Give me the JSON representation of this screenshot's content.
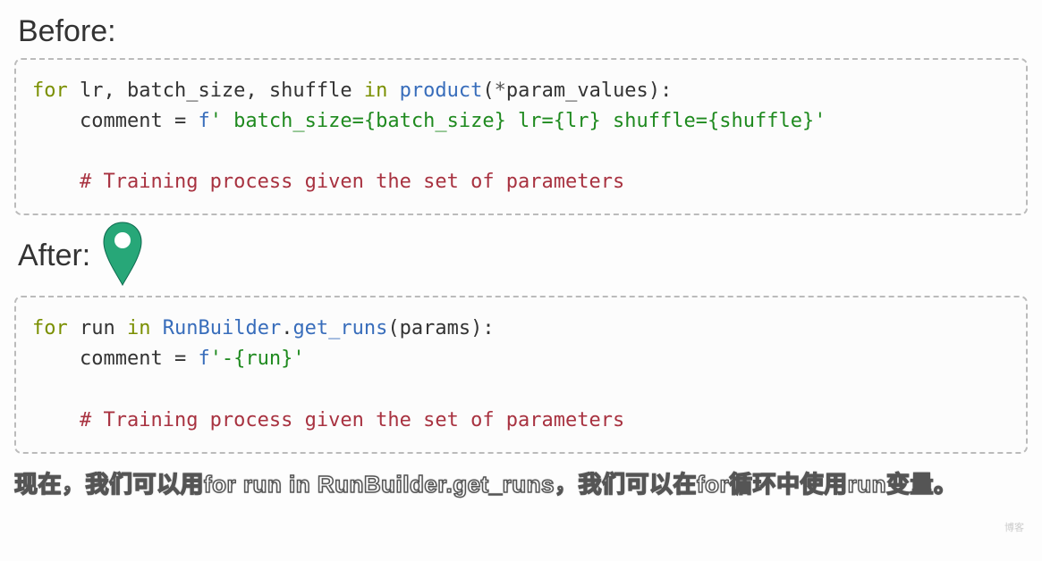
{
  "headings": {
    "before": "Before:",
    "after": "After:"
  },
  "before_code": {
    "line1": {
      "kw_for": "for",
      "vars": " lr, batch_size, shuffle ",
      "kw_in": "in",
      "space1": " ",
      "func": "product",
      "paren_open": "(",
      "star": "*",
      "arg": "param_values",
      "paren_close": ")",
      "colon": ":"
    },
    "line2": {
      "indent": "    ",
      "assign": "comment = ",
      "fprefix": "f",
      "str": "' batch_size={batch_size} lr={lr} shuffle={shuffle}'"
    },
    "line4": {
      "indent": "    ",
      "comment": "# Training process given the set of parameters"
    }
  },
  "after_code": {
    "line1": {
      "kw_for": "for",
      "var": " run ",
      "kw_in": "in",
      "space1": " ",
      "cls": "RunBuilder",
      "dot": ".",
      "method": "get_runs",
      "paren_open": "(",
      "arg": "params",
      "paren_close": ")",
      "colon": ":"
    },
    "line2": {
      "indent": "    ",
      "assign": "comment = ",
      "fprefix": "f",
      "str": "'-{run}'"
    },
    "line4": {
      "indent": "    ",
      "comment": "# Training process given the set of parameters"
    }
  },
  "subtitle": "现在，我们可以用for run in RunBuilder.get_runs，我们可以在for循环中使用run变量。",
  "cursor": {
    "semantic": "location-pin-icon"
  },
  "watermark": "博客"
}
